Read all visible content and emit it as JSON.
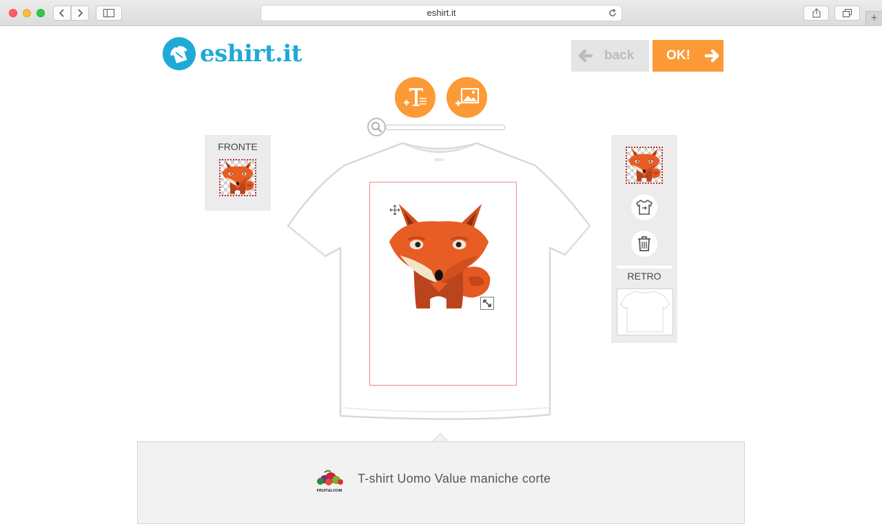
{
  "browser": {
    "url": "eshirt.it",
    "new_tab_label": "+"
  },
  "header": {
    "logo_text": "eshirt.it",
    "back_label": "back",
    "ok_label": "OK!"
  },
  "tools": [
    {
      "name": "add-text",
      "icon": "add-text-icon"
    },
    {
      "name": "add-image",
      "icon": "add-image-icon"
    }
  ],
  "zoom": {
    "level": 0
  },
  "front_panel": {
    "title": "FRONTE"
  },
  "back_panel": {
    "title": "RETRO"
  },
  "colors": {
    "accent": "#fc9a36",
    "brand": "#1fa9d6",
    "print_border": "#e88888"
  },
  "product": {
    "name": "T-shirt Uomo Value maniche corte",
    "brand_logo_text": "FRUIT OF THE LOOM"
  }
}
